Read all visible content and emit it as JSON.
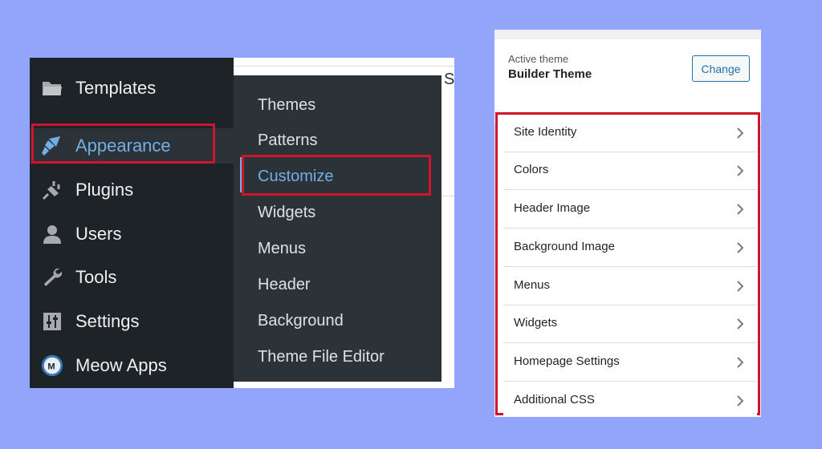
{
  "admin_menu": {
    "items": [
      {
        "label": "Templates",
        "icon": "folder-icon"
      },
      {
        "label": "Appearance",
        "icon": "paintbrush-icon"
      },
      {
        "label": "Plugins",
        "icon": "plug-icon"
      },
      {
        "label": "Users",
        "icon": "user-icon"
      },
      {
        "label": "Tools",
        "icon": "wrench-icon"
      },
      {
        "label": "Settings",
        "icon": "sliders-icon"
      },
      {
        "label": "Meow Apps",
        "icon": "meow-apps-icon"
      }
    ],
    "active": "Appearance"
  },
  "appearance_submenu": {
    "items": [
      "Themes",
      "Patterns",
      "Customize",
      "Widgets",
      "Menus",
      "Header",
      "Background",
      "Theme File Editor"
    ],
    "current": "Customize"
  },
  "customizer": {
    "active_theme_label": "Active theme",
    "theme_name": "Builder Theme",
    "change_label": "Change",
    "sections": [
      "Site Identity",
      "Colors",
      "Header Image",
      "Background Image",
      "Menus",
      "Widgets",
      "Homepage Settings",
      "Additional CSS"
    ]
  },
  "colors": {
    "background": "#93a4fb",
    "admin_sidebar": "#1d2327",
    "submenu": "#2c3338",
    "accent_blue": "#72aee6",
    "highlight_red": "#d0142c"
  }
}
